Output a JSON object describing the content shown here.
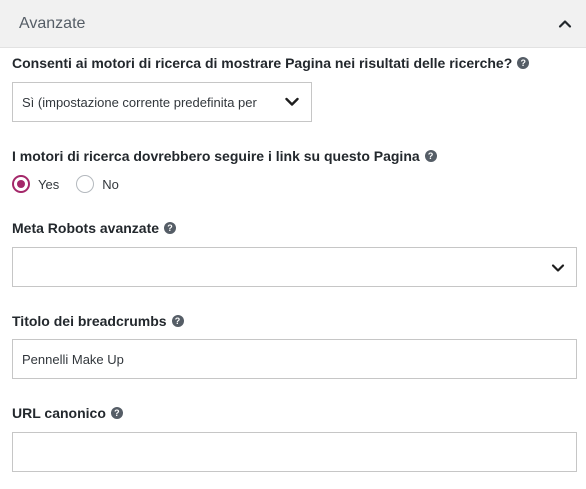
{
  "panel": {
    "title": "Avanzate",
    "toggle_icon": "chevron-up-icon"
  },
  "fields": {
    "search_visibility": {
      "label": "Consenti ai motori di ricerca di mostrare Pagina nei risultati delle ricerche?",
      "help_icon": "question-circle-icon",
      "value": "Sì (impostazione corrente predefinita per"
    },
    "follow_links": {
      "label": "I motori di ricerca dovrebbero seguire i link su questo Pagina",
      "help_icon": "question-circle-icon",
      "options": [
        {
          "label": "Yes",
          "checked": true
        },
        {
          "label": "No",
          "checked": false
        }
      ]
    },
    "meta_robots": {
      "label": "Meta Robots avanzate",
      "help_icon": "question-circle-icon",
      "value": ""
    },
    "breadcrumb_title": {
      "label": "Titolo dei breadcrumbs",
      "help_icon": "question-circle-icon",
      "value": "Pennelli Make Up"
    },
    "canonical_url": {
      "label": "URL canonico",
      "help_icon": "question-circle-icon",
      "value": ""
    }
  },
  "colors": {
    "accent": "#a4286a",
    "header_bg": "#f1f1f1",
    "border": "#c6c6c6"
  }
}
